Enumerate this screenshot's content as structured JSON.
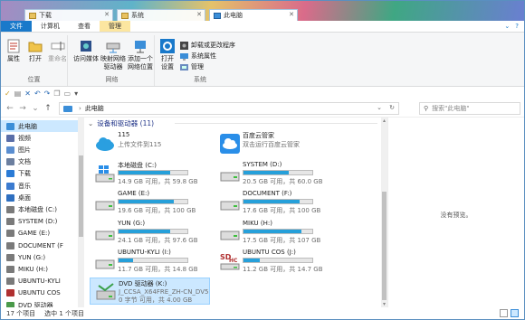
{
  "titlebar": {
    "tabs": [
      {
        "label": "下载",
        "active": false
      },
      {
        "label": "系统",
        "active": false
      },
      {
        "label": "此电脑",
        "active": true
      }
    ]
  },
  "ribbon_tabs": {
    "file": "文件",
    "computer": "计算机",
    "view": "查看",
    "manage": "管理"
  },
  "ribbon": {
    "groups": {
      "location": {
        "label": "位置",
        "properties": "属性",
        "open": "打开",
        "rename": "重命名"
      },
      "network": {
        "label": "网络",
        "access_media": "访问媒体",
        "map_drive": "映射网络\n驱动器",
        "add_location": "添加一个\n网络位置"
      },
      "system": {
        "label": "系统",
        "open_settings": "打开\n设置",
        "uninstall": "卸载或更改程序",
        "sys_props": "系统属性",
        "manage": "管理"
      }
    }
  },
  "address": {
    "path": "此电脑",
    "search_placeholder": "搜索\"此电脑\""
  },
  "nav": {
    "items": [
      {
        "label": "此电脑",
        "selected": true,
        "color": "#3b8ed8"
      },
      {
        "label": "视频",
        "selected": false,
        "color": "#5a6ea8"
      },
      {
        "label": "图片",
        "selected": false,
        "color": "#5a8ed0"
      },
      {
        "label": "文档",
        "selected": false,
        "color": "#6c7f9f"
      },
      {
        "label": "下载",
        "selected": false,
        "color": "#2a7bd6"
      },
      {
        "label": "音乐",
        "selected": false,
        "color": "#3b7bd0"
      },
      {
        "label": "桌面",
        "selected": false,
        "color": "#2e6fc0"
      },
      {
        "label": "本地磁盘 (C:)",
        "selected": false,
        "color": "#7a7a7a"
      },
      {
        "label": "SYSTEM (D:)",
        "selected": false,
        "color": "#7a7a7a"
      },
      {
        "label": "GAME (E:)",
        "selected": false,
        "color": "#7a7a7a"
      },
      {
        "label": "DOCUMENT (F",
        "selected": false,
        "color": "#7a7a7a"
      },
      {
        "label": "YUN (G:)",
        "selected": false,
        "color": "#7a7a7a"
      },
      {
        "label": "MIKU (H:)",
        "selected": false,
        "color": "#7a7a7a"
      },
      {
        "label": "UBUNTU-KYLI",
        "selected": false,
        "color": "#7a7a7a"
      },
      {
        "label": "UBUNTU COS",
        "selected": false,
        "color": "#b03030"
      },
      {
        "label": "DVD 驱动器",
        "selected": false,
        "color": "#4a9a4a"
      }
    ]
  },
  "main": {
    "group_header": "设备和驱动器 (11)",
    "items": [
      {
        "name": "115",
        "sub": "上传文件到115",
        "type": "cloud",
        "usage": null
      },
      {
        "name": "百度云管家",
        "sub": "双击运行百度云管家",
        "type": "baidu",
        "usage": null
      },
      {
        "name": "本地磁盘 (C:)",
        "sub": "14.9 GB 可用，共 59.8 GB",
        "type": "windrive",
        "usage": 0.75
      },
      {
        "name": "SYSTEM (D:)",
        "sub": "20.5 GB 可用，共 60.0 GB",
        "type": "drive",
        "usage": 0.66
      },
      {
        "name": "GAME (E:)",
        "sub": "19.6 GB 可用，共 100 GB",
        "type": "drive",
        "usage": 0.8
      },
      {
        "name": "DOCUMENT (F:)",
        "sub": "17.6 GB 可用，共 100 GB",
        "type": "drive",
        "usage": 0.82
      },
      {
        "name": "YUN (G:)",
        "sub": "24.1 GB 可用，共 97.6 GB",
        "type": "drive",
        "usage": 0.75
      },
      {
        "name": "MIKU (H:)",
        "sub": "17.5 GB 可用，共 107 GB",
        "type": "drive",
        "usage": 0.84
      },
      {
        "name": "UBUNTU-KYLI (I:)",
        "sub": "11.7 GB 可用，共 14.8 GB",
        "type": "drive",
        "usage": 0.21
      },
      {
        "name": "UBUNTU COS (J:)",
        "sub": "11.2 GB 可用，共 14.7 GB",
        "type": "sdhc",
        "usage": 0.24
      },
      {
        "name": "DVD 驱动器 (K:)",
        "sub": "J_CCSA_X64FRE_ZH-CN_DV5",
        "sub2": "0 字节 可用，共 4.00 GB",
        "type": "dvd",
        "usage": null,
        "selected": true
      }
    ]
  },
  "preview": {
    "text": "没有预览。"
  },
  "status": {
    "count": "17 个项目",
    "selected": "选中 1 个项目"
  }
}
